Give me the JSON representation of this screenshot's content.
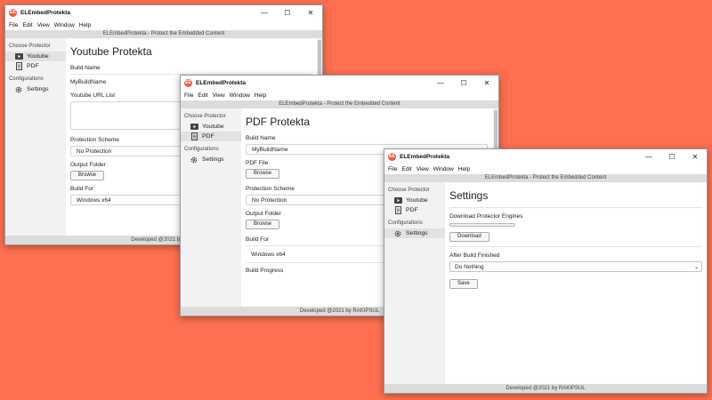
{
  "app": {
    "icon_text": "EE",
    "title": "ELEmbedProtekta",
    "subtitle": "ELEmbedProtekta - Protect the Embedded Content",
    "menu": [
      "File",
      "Edit",
      "View",
      "Window",
      "Help"
    ],
    "footer": "Developed @2021 by RAKIPSUL",
    "footer_truncated": "Developed @2021 by RAKI",
    "controls": {
      "minimize": "—",
      "maximize": "☐",
      "close": "✕"
    }
  },
  "sidebar": {
    "choose_header": "Choose Protector",
    "items": [
      "Youtube",
      "PDF"
    ],
    "config_header": "Configurations",
    "settings": "Settings"
  },
  "youtube_window": {
    "page_title": "Youtube Protekta",
    "build_name_label": "Build Name",
    "build_name_value": "MyBuildName",
    "url_list_label": "Youtube URL List",
    "protection_label": "Protection Scheme",
    "protection_value": "No Protection",
    "output_label": "Output Folder",
    "browse": "Browse",
    "build_for_label": "Build For",
    "build_for_value": "Windows x64"
  },
  "pdf_window": {
    "page_title": "PDF Protekta",
    "build_name_label": "Build Name",
    "build_name_value": "MyBuildName",
    "pdf_file_label": "PDF File",
    "browse": "Browse",
    "protection_label": "Protection Scheme",
    "protection_value": "No Protection",
    "output_label": "Output Folder",
    "build_for_label": "Build For",
    "build_for_value": "Windows x64",
    "progress_label": "Build Progress"
  },
  "settings_window": {
    "page_title": "Settings",
    "download_label": "Download Protector Engines",
    "download_progress": 0,
    "download_button": "Download",
    "after_build_label": "After Build Finished",
    "after_build_value": "Do Nothing",
    "save_button": "Save"
  },
  "colors": {
    "background": "#ff6f50",
    "app_icon": "#f05a3c"
  }
}
